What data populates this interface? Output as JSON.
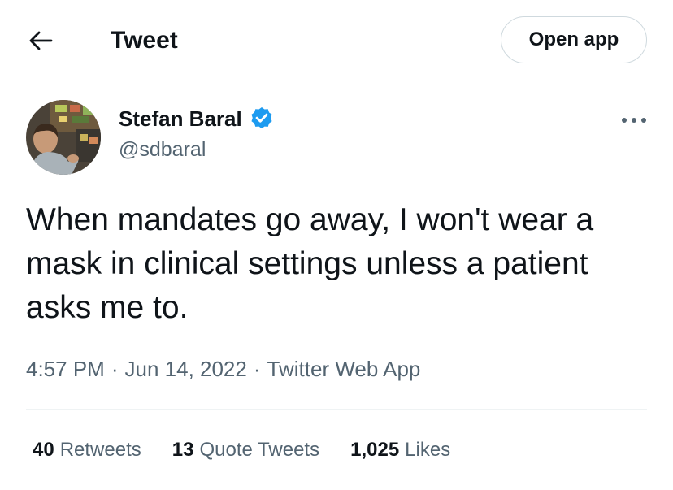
{
  "header": {
    "title": "Tweet",
    "back_icon": "arrow-left-icon",
    "open_app_label": "Open app"
  },
  "author": {
    "name": "Stefan Baral",
    "handle": "@sdbaral",
    "verified": true,
    "verified_icon": "verified-badge-icon"
  },
  "tweet": {
    "text": "When mandates go away, I won't wear a mask in clinical settings unless a patient asks me to.",
    "time": "4:57 PM",
    "separator": "·",
    "date": "Jun 14, 2022",
    "source": "Twitter Web App"
  },
  "stats": {
    "retweets_count": "40",
    "retweets_label": "Retweets",
    "quotes_count": "13",
    "quotes_label": "Quote Tweets",
    "likes_count": "1,025",
    "likes_label": "Likes"
  },
  "colors": {
    "text": "#0f1419",
    "secondary": "#536471",
    "verified": "#1d9bf0",
    "border": "#cfd9de",
    "divider": "#eff3f4"
  }
}
